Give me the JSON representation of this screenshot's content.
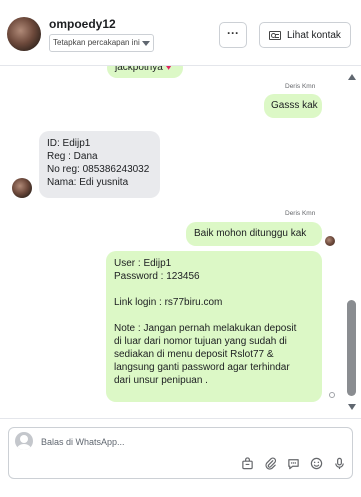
{
  "header": {
    "contact_name": "ompoedy12",
    "pin_select_value": "Tetapkan percakapan ini",
    "more_label": "···",
    "view_contact_label": "Lihat kontak"
  },
  "messages": {
    "m0_text": "jackpotnya",
    "m0_emoji": "♥",
    "m1_sender": "Deris Kmn",
    "m1_text": "Gasss kak",
    "m2_lines": [
      "ID: Edijp1",
      "Reg : Dana",
      "No reg: 085386243032",
      "Nama: Edi yusnita"
    ],
    "m3_sender": "Deris Kmn",
    "m3_text": "Baik mohon ditunggu kak",
    "m4_lines": [
      "User : Edijp1",
      "Password : 123456",
      "",
      "Link login : rs77biru.com",
      "",
      "Note : Jangan pernah melakukan deposit",
      "di luar dari nomor tujuan yang sudah di",
      "sediakan di menu deposit Rslot77 &",
      "langsung ganti password agar terhindar",
      "dari unsur penipuan ."
    ]
  },
  "composer": {
    "placeholder": "Balas di WhatsApp...",
    "tools": [
      "bag-icon",
      "paperclip-icon",
      "quick-reply-icon",
      "emoji-icon",
      "microphone-icon"
    ]
  },
  "colors": {
    "outgoing_bubble": "#dcf8c6",
    "incoming_bubble": "#e9eaed",
    "heart": "#e0245e"
  }
}
